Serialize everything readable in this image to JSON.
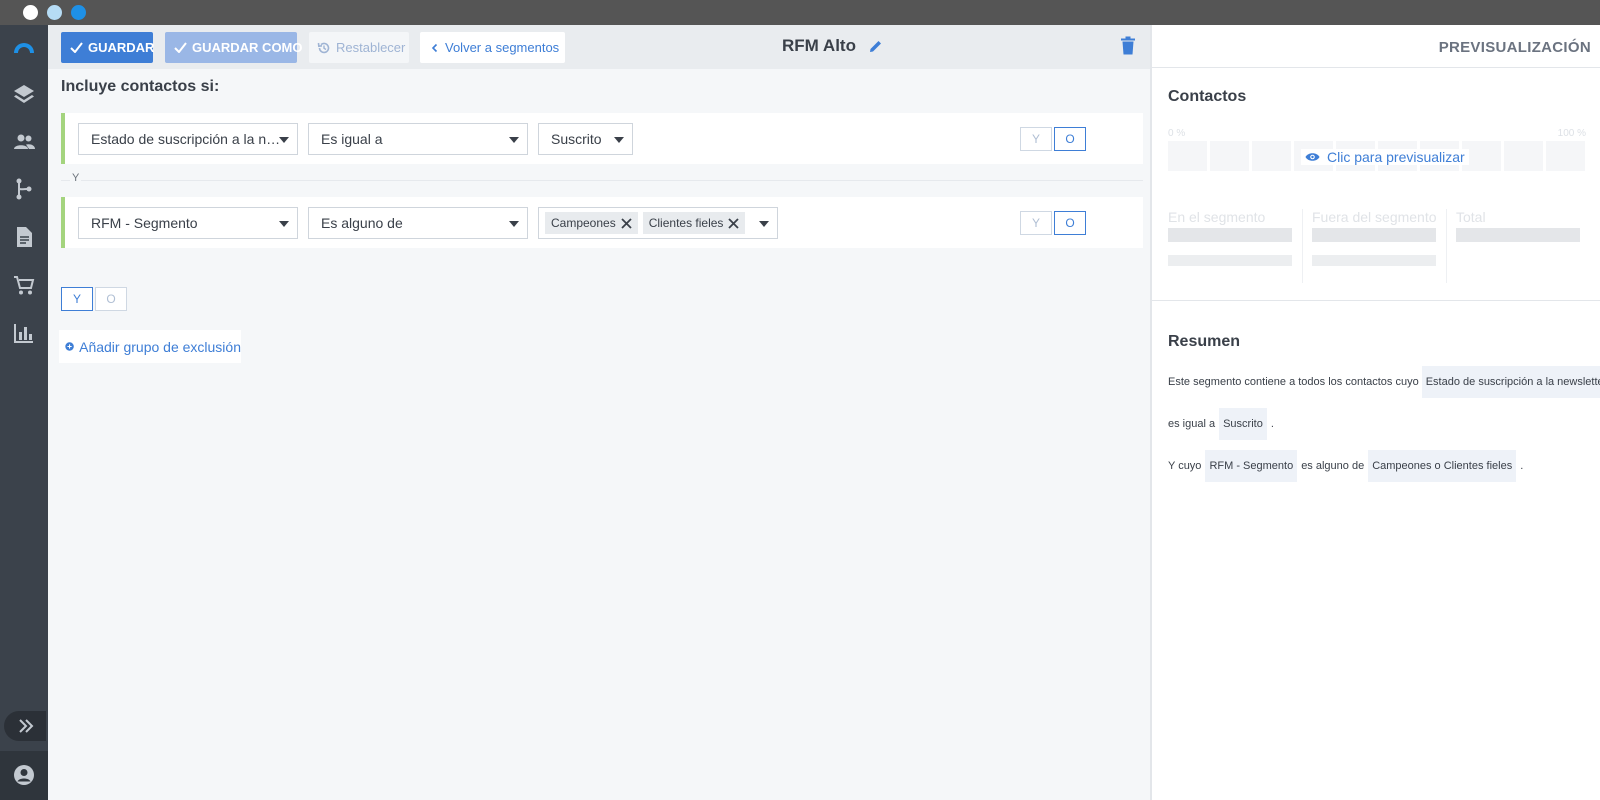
{
  "toolbar": {
    "save_label": "GUARDAR",
    "save_as_label": "GUARDAR COMO",
    "reset_label": "Restablecer",
    "back_label": "Volver a segmentos",
    "segment_title": "RFM Alto"
  },
  "builder": {
    "include_heading": "Incluye contactos si:",
    "rules": [
      {
        "field": "Estado de suscripción a la newsletter",
        "operator": "Es igual a",
        "value": "Suscrito",
        "y_label": "Y",
        "o_label": "O"
      },
      {
        "field": "RFM - Segmento",
        "operator": "Es alguno de",
        "values": [
          "Campeones",
          "Clientes fieles"
        ],
        "y_label": "Y",
        "o_label": "O"
      }
    ],
    "connector": "Y",
    "group_y": "Y",
    "group_o": "O",
    "add_exclusion_label": "Añadir grupo de exclusión"
  },
  "preview": {
    "header": "PREVISUALIZACIÓN",
    "contacts_heading": "Contactos",
    "pct_min": "0 %",
    "pct_max": "100 %",
    "click_preview": "Clic para previsualizar",
    "stats": [
      "En el segmento",
      "Fuera del segmento",
      "Total"
    ],
    "summary_heading": "Resumen",
    "summary": {
      "l1_text": "Este segmento contiene a todos los contactos cuyo",
      "l1_tag": "Estado de suscripción a la newsletter",
      "l2_text": "es igual a",
      "l2_tag": "Suscrito",
      "l2_end": ".",
      "l3_text": "Y cuyo",
      "l3_tag1": "RFM - Segmento",
      "l3_mid": "es alguno de",
      "l3_tag2": "Campeones o Clientes fieles",
      "l3_end": "."
    }
  },
  "colors": {
    "accent": "#3e7ed6",
    "rule_border": "#a4d47e",
    "sidebar": "#3b424b"
  },
  "icons": [
    "logo-icon",
    "layers-icon",
    "contacts-icon",
    "flow-icon",
    "document-icon",
    "cart-icon",
    "chart-icon",
    "expand-icon",
    "user-icon",
    "check-icon",
    "history-icon",
    "chevron-left-icon",
    "pencil-icon",
    "trash-icon",
    "close-icon",
    "plus-circle-icon",
    "eye-icon"
  ]
}
